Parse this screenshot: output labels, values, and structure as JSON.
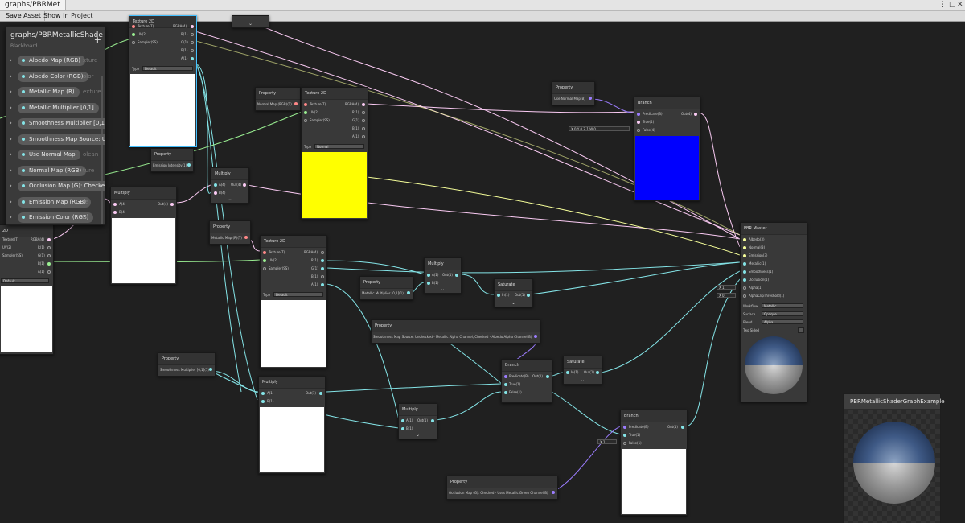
{
  "window": {
    "tab_title": "graphs/PBRMet"
  },
  "toolbar": {
    "save_asset": "Save Asset",
    "show_in_project": "Show In Project"
  },
  "blackboard": {
    "title": "graphs/PBRMetallicShade",
    "subtitle": "Blackboard",
    "add_symbol": "+",
    "properties": [
      {
        "label": "Albedo Map (RGB)",
        "ghost": "xture"
      },
      {
        "label": "Albedo Color (RGB)",
        "ghost": "olor"
      },
      {
        "label": "Metallic Map (R)",
        "ghost": "exture"
      },
      {
        "label": "Metallic Multiplier [0,1]",
        "ghost": ""
      },
      {
        "label": "Smoothness Multiplier [0,1",
        "ghost": ""
      },
      {
        "label": "Smoothness Map Source: U",
        "ghost": ""
      },
      {
        "label": "Use Normal Map",
        "ghost": "olean"
      },
      {
        "label": "Normal Map (RGB)",
        "ghost": "ture"
      },
      {
        "label": "Occlusion Map (G): Checke",
        "ghost": ""
      },
      {
        "label": "Emission Map (RGB)",
        "ghost": "re"
      },
      {
        "label": "Emission Color (RGB)",
        "ghost": "or"
      }
    ]
  },
  "nodes": {
    "tex_top": {
      "title": "Texture 2D",
      "in": [
        "Texture(T)",
        "UV(2)",
        "Sampler(SS)"
      ],
      "out": [
        "RGBA(4)",
        "R(1)",
        "G(1)",
        "B(1)",
        "A(1)"
      ],
      "type_label": "Type",
      "type_value": "Default",
      "cutoff_in": "T)"
    },
    "prop_normal": {
      "title": "Property",
      "port": "Normal Map (RGB)(T)"
    },
    "tex_normal": {
      "title": "Texture 2D",
      "in": [
        "Texture(T)",
        "UV(2)",
        "Sampler(SS)"
      ],
      "out": [
        "RGBA(4)",
        "R(1)",
        "G(1)",
        "B(1)",
        "A(1)"
      ],
      "type_label": "Type",
      "type_value": "Normal"
    },
    "prop_usenormal": {
      "title": "Property",
      "port": "Use Normal Map(B)"
    },
    "branch_normal": {
      "title": "Branch",
      "in": [
        "Predicate(B)",
        "True(4)",
        "False(4)"
      ],
      "out": "Out(4)",
      "false_value": "X 0  Y 0  Z 1  W 0"
    },
    "prop_emission": {
      "title": "Property",
      "port": "Emission Intensity(1)"
    },
    "multiply_emission": {
      "title": "Multiply",
      "in": [
        "A(4)",
        "B(4)"
      ],
      "out": "Out(4)"
    },
    "multiply_color": {
      "title": "Multiply",
      "in": [
        "A(4)",
        "B(4)"
      ],
      "out": "Out(4)"
    },
    "tex_left": {
      "title": "2D",
      "in": [
        "Texture(T)",
        "UV(2)",
        "Sampler(SS)"
      ],
      "out": [
        "RGBA(4)",
        "R(1)",
        "G(1)",
        "B(1)",
        "A(1)"
      ],
      "type_value": "Default"
    },
    "prop_metallic": {
      "title": "Property",
      "port": "Metallic Map (R)(T)"
    },
    "tex_metallic": {
      "title": "Texture 2D",
      "in": [
        "Texture(T)",
        "UV(2)",
        "Sampler(SS)"
      ],
      "out": [
        "RGBA(4)",
        "R(1)",
        "G(1)",
        "B(1)",
        "A(1)"
      ],
      "type_label": "Type",
      "type_value": "Default"
    },
    "multiply_metal": {
      "title": "Multiply",
      "in": [
        "A(1)",
        "B(1)"
      ],
      "out": "Out(1)"
    },
    "prop_metalmult": {
      "title": "Property",
      "port": "Metallic Multiplier [0,1](1)"
    },
    "saturate_metal": {
      "title": "Saturate",
      "in": "In(1)",
      "out": "Out(1)"
    },
    "prop_smoothsource": {
      "title": "Property",
      "port": "Smoothness Map Source: Unchecked - Metallic Alpha Channel, Checked - Albedo Alpha Channel(B)"
    },
    "branch_smooth": {
      "title": "Branch",
      "in": [
        "Predicate(B)",
        "True(1)",
        "False(1)"
      ],
      "out": "Out(1)"
    },
    "saturate_smooth": {
      "title": "Saturate",
      "in": "In(1)",
      "out": "Out(1)"
    },
    "prop_smoothmult": {
      "title": "Property",
      "port": "Smoothness Multiplier [0,1](1)"
    },
    "multiply_smooth_a": {
      "title": "Multiply",
      "in": [
        "A(1)",
        "B(1)"
      ],
      "out": "Out(1)"
    },
    "multiply_smooth_b": {
      "title": "Multiply",
      "in": [
        "A(1)",
        "B(1)"
      ],
      "out": "Out(1)"
    },
    "branch_occlusion": {
      "title": "Branch",
      "in": [
        "Predicate(B)",
        "True(1)",
        "False(1)"
      ],
      "out": "Out(1)",
      "false_value": "X 1"
    },
    "prop_occlusion": {
      "title": "Property",
      "port": "Occlusion Map (G): Checked - Uses Metallic Green Channel(B)"
    },
    "pbr_master": {
      "title": "PBR Master",
      "in": [
        "Albedo(3)",
        "Normal(3)",
        "Emission(3)",
        "Metallic(1)",
        "Smoothness(1)",
        "Occlusion(1)",
        "Alpha(1)",
        "AlphaClipThreshold(1)"
      ],
      "alpha_value": "X 1",
      "clip_value": "X 0",
      "settings": [
        {
          "label": "Workflow",
          "value": "Metallic"
        },
        {
          "label": "Surface",
          "value": "Opaque"
        },
        {
          "label": "Blend",
          "value": "Alpha"
        },
        {
          "label": "Two Sided",
          "value": ""
        }
      ]
    }
  },
  "main_preview": {
    "title": "PBRMetallicShaderGraphExample"
  },
  "colors": {
    "canvas": "#202020",
    "node": "#393939",
    "selected_border": "#44c0ff",
    "wire_vec1": "#84e4e7",
    "wire_vec4": "#fbcbf4",
    "wire_vec3": "#f6ff9a",
    "wire_vec2": "#9aef92",
    "wire_bool": "#9c7dff"
  }
}
